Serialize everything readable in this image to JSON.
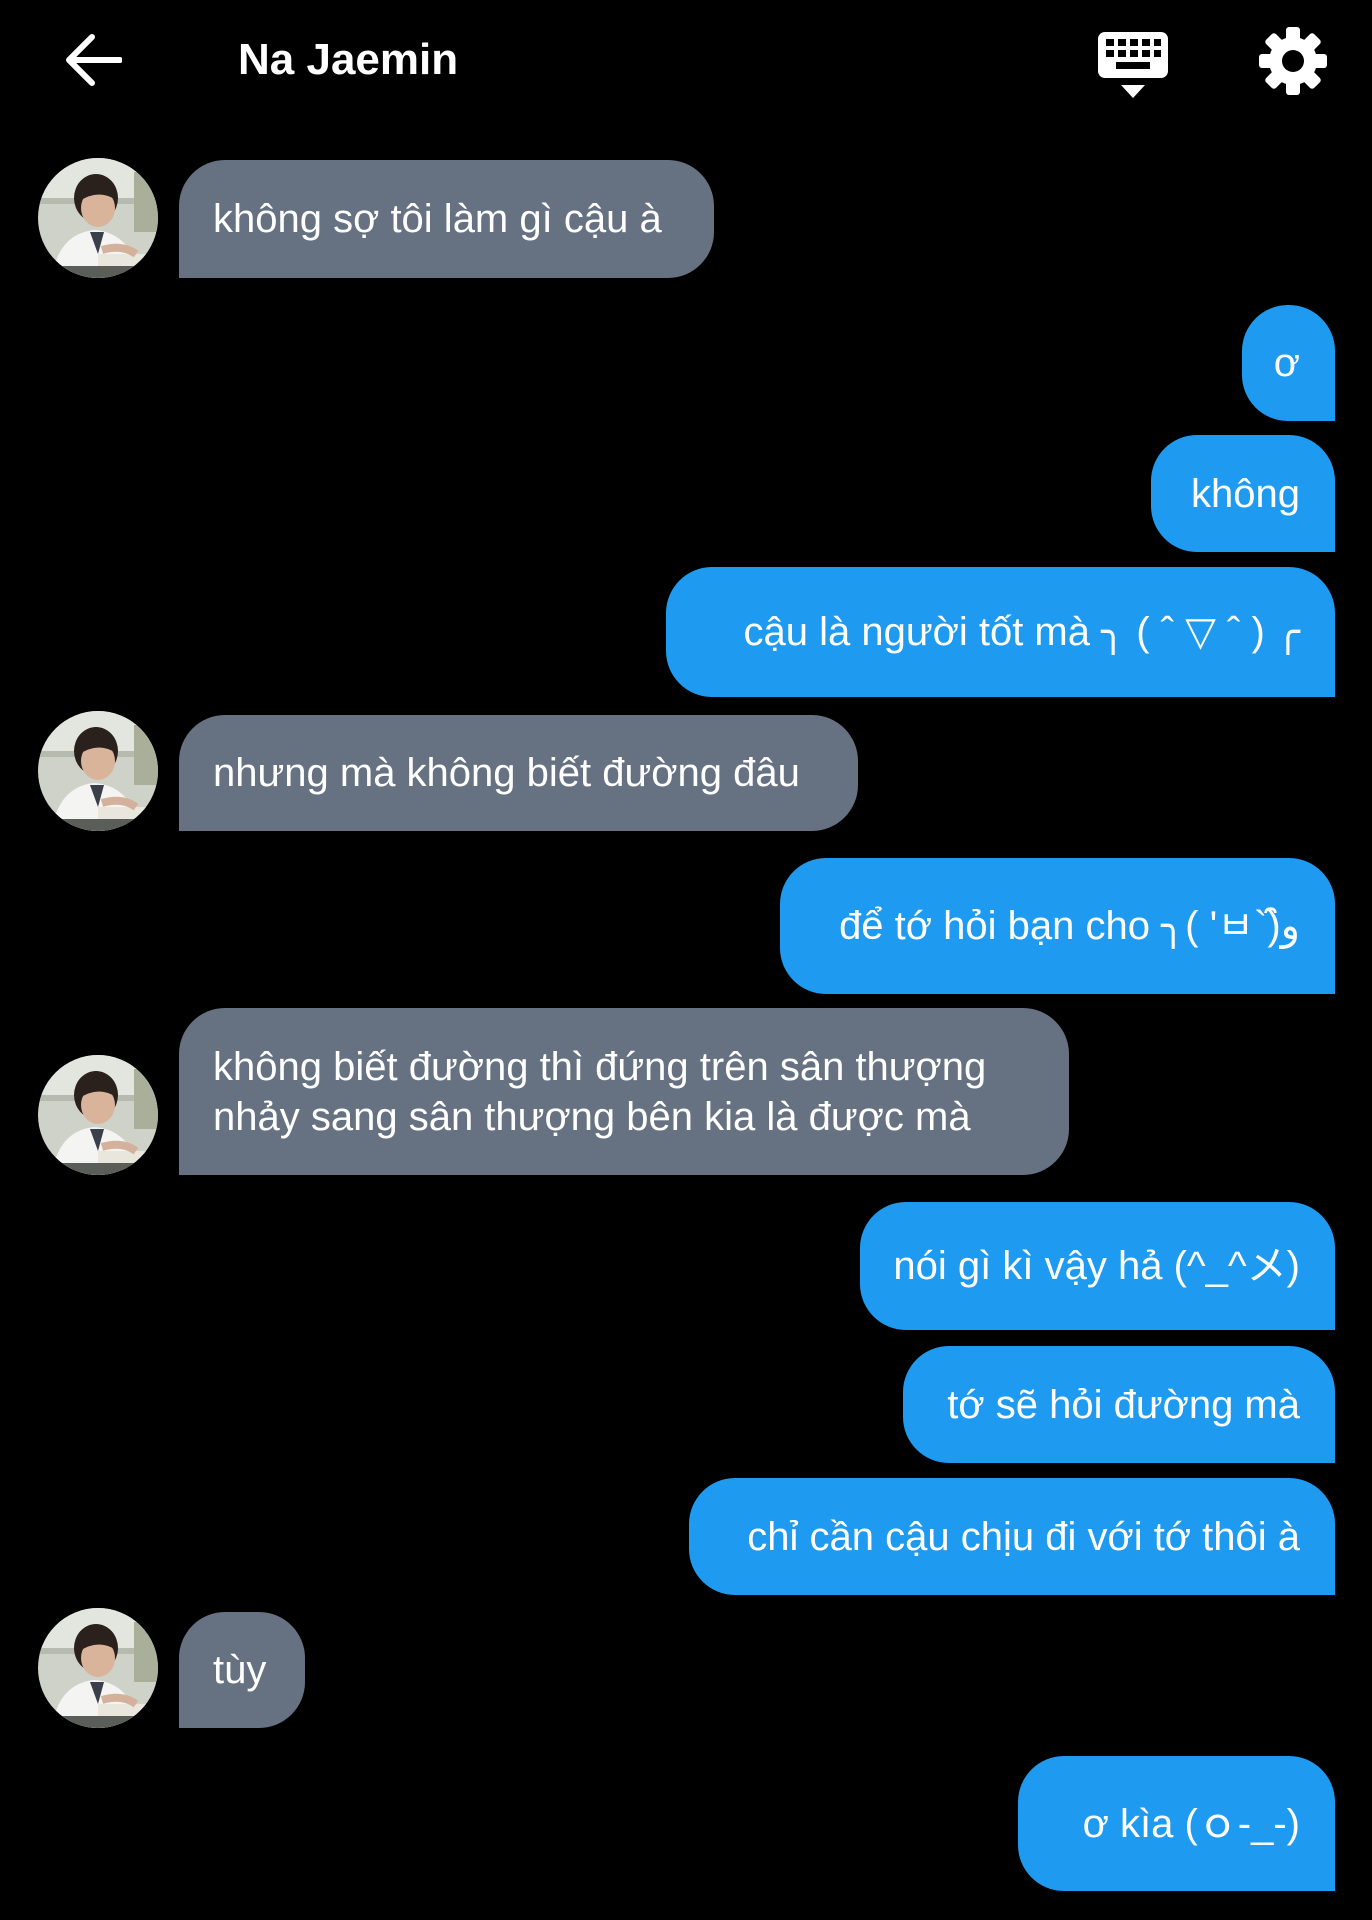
{
  "header": {
    "title": "Na Jaemin",
    "back_icon": "arrow-left-icon",
    "keyboard_icon": "keyboard-hide-icon",
    "settings_icon": "gear-icon"
  },
  "colors": {
    "background": "#000000",
    "incoming_bubble": "#667281",
    "outgoing_bubble": "#1e9bf0",
    "text": "#ffffff"
  },
  "messages": [
    {
      "from": "contact",
      "text": "không sợ tôi làm gì cậu à"
    },
    {
      "from": "me",
      "text": "ơ"
    },
    {
      "from": "me",
      "text": "không"
    },
    {
      "from": "me",
      "text": "cậu là người tốt mà ╮ ( ˆ ▽ ˆ ) ╭"
    },
    {
      "from": "contact",
      "text": "nhưng mà không biết đường đâu"
    },
    {
      "from": "me",
      "text": "để tớ hỏi bạn cho ╮( 'ㅂ`)و̑̑"
    },
    {
      "from": "contact",
      "lines": [
        "không biết đường thì đứng trên sân thượng",
        "nhảy sang sân thượng bên kia là được mà"
      ]
    },
    {
      "from": "me",
      "text": "nói gì kì vậy hả (^_^メ)"
    },
    {
      "from": "me",
      "text": "tớ sẽ hỏi đường mà"
    },
    {
      "from": "me",
      "text": "chỉ cần cậu chịu đi với tớ thôi à"
    },
    {
      "from": "contact",
      "text": "tùy"
    },
    {
      "from": "me",
      "text": "ơ kìa (ｏ‐_‐)"
    }
  ]
}
